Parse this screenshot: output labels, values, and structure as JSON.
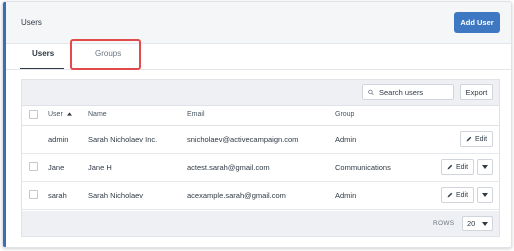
{
  "header": {
    "title": "Users",
    "add_user_label": "Add User"
  },
  "tabs": [
    {
      "label": "Users",
      "active": true
    },
    {
      "label": "Groups",
      "active": false
    }
  ],
  "toolbar": {
    "search_placeholder": "Search users",
    "export_label": "Export"
  },
  "table": {
    "columns": {
      "user": "User",
      "name": "Name",
      "email": "Email",
      "group": "Group"
    },
    "sort": {
      "column": "user",
      "direction": "ascending"
    },
    "rows": [
      {
        "user": "admin",
        "name": "Sarah Nicholaev Inc.",
        "email": "snicholaev@activecampaign.com",
        "group": "Admin",
        "edit_label": "Edit"
      },
      {
        "user": "Jane",
        "name": "Jane H",
        "email": "actest.sarah@gmail.com",
        "group": "Communications",
        "edit_label": "Edit"
      },
      {
        "user": "sarah",
        "name": "Sarah Nicholaev",
        "email": "acexample.sarah@gmail.com",
        "group": "Admin",
        "edit_label": "Edit"
      }
    ]
  },
  "footer": {
    "rows_label": "ROWS",
    "rows_value": "20"
  },
  "colors": {
    "accent": "#3a6fb5",
    "primary_button": "#3e78c2",
    "highlight": "#e14b4b"
  }
}
